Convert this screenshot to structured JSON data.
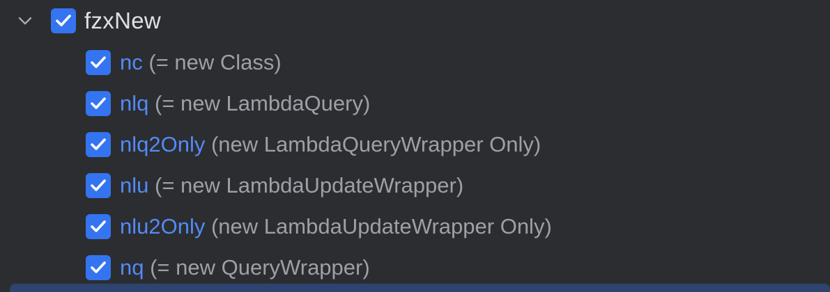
{
  "group": {
    "label": "fzxNew",
    "expanded": true,
    "checked": true
  },
  "items": [
    {
      "key": "nc",
      "desc": "(= new Class)",
      "checked": true
    },
    {
      "key": "nlq",
      "desc": "(= new LambdaQuery)",
      "checked": true
    },
    {
      "key": "nlq2Only",
      "desc": "(new LambdaQueryWrapper Only)",
      "checked": true
    },
    {
      "key": "nlu",
      "desc": "(= new LambdaUpdateWrapper)",
      "checked": true
    },
    {
      "key": "nlu2Only",
      "desc": "(new LambdaUpdateWrapper Only)",
      "checked": true
    },
    {
      "key": "nq",
      "desc": "(= new QueryWrapper)",
      "checked": true
    }
  ],
  "colors": {
    "background": "#2b2d30",
    "checkbox": "#3574f0",
    "key_text": "#548af7",
    "desc_text": "#9da0a8",
    "group_text": "#dfe1e5",
    "selection": "#2e436e"
  }
}
